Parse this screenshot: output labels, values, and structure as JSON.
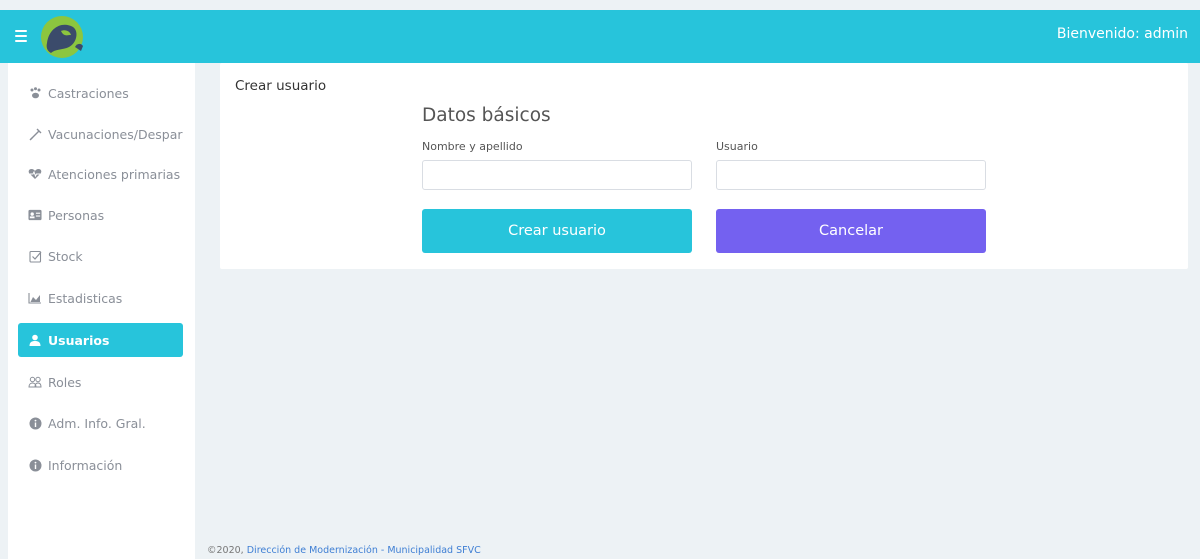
{
  "colors": {
    "accent": "#27c4db",
    "cancel": "#7461f0",
    "background": "#edf2f5",
    "sidebar_text": "#8a8f98"
  },
  "header": {
    "welcome": "Bienvenido: admin"
  },
  "sidebar": {
    "items": [
      {
        "label": "Castraciones",
        "icon": "paw-icon"
      },
      {
        "label": "Vacunaciones/Desparasitaciones",
        "icon": "syringe-icon"
      },
      {
        "label": "Atenciones primarias",
        "icon": "heartbeat-icon"
      },
      {
        "label": "Personas",
        "icon": "id-card-icon"
      },
      {
        "label": "Stock",
        "icon": "checkbox-icon"
      },
      {
        "label": "Estadisticas",
        "icon": "chart-area-icon"
      },
      {
        "label": "Usuarios",
        "icon": "user-icon",
        "active": true
      },
      {
        "label": "Roles",
        "icon": "users-icon"
      },
      {
        "label": "Adm. Info. Gral.",
        "icon": "info-circle-icon"
      },
      {
        "label": "Información",
        "icon": "info-circle-icon"
      }
    ]
  },
  "main": {
    "card_title": "Crear usuario",
    "section_title": "Datos básicos",
    "fields": {
      "name_label": "Nombre y apellido",
      "name_value": "",
      "user_label": "Usuario",
      "user_value": ""
    },
    "buttons": {
      "create": "Crear usuario",
      "cancel": "Cancelar"
    }
  },
  "footer": {
    "copyright": "©2020,",
    "link": "Dirección de Modernización - Municipalidad SFVC"
  }
}
